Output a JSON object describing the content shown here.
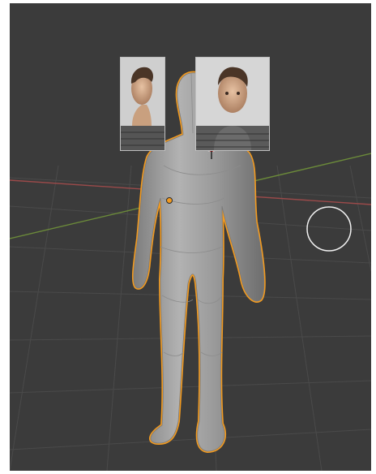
{
  "viewport": {
    "background_color": "#3b3b3b",
    "x_axis_color": "#9a4a4a",
    "y_axis_color": "#6b8a3a",
    "selection_outline_color": "#f29a1f",
    "mesh_color": "#9a9a9a"
  },
  "scene": {
    "object": "human base mesh",
    "reference_images": [
      "side-profile-reference",
      "front-reference"
    ]
  }
}
